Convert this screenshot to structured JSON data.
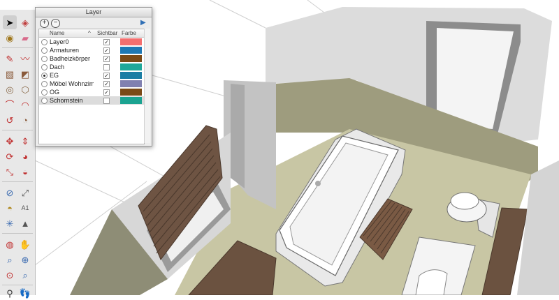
{
  "panel": {
    "title": "Layer",
    "add_icon": "+",
    "remove_icon": "−",
    "columns": {
      "name": "Name",
      "sort": "^",
      "visible": "Sichtbar",
      "color": "Farbe"
    }
  },
  "layers": [
    {
      "name": "Layer0",
      "active": false,
      "visible": true,
      "color": "#f46f6f"
    },
    {
      "name": "Armaturen",
      "active": false,
      "visible": true,
      "color": "#1e78b4"
    },
    {
      "name": "Badheizkörper",
      "active": false,
      "visible": true,
      "color": "#7a4a17"
    },
    {
      "name": "Dach",
      "active": false,
      "visible": false,
      "color": "#1fa89a"
    },
    {
      "name": "EG",
      "active": true,
      "visible": true,
      "color": "#1b7ea4"
    },
    {
      "name": "Möbel Wohnzimmer",
      "active": false,
      "visible": true,
      "color": "#8080b0"
    },
    {
      "name": "OG",
      "active": false,
      "visible": true,
      "color": "#7a4a17"
    },
    {
      "name": "Schornstein",
      "active": false,
      "visible": false,
      "color": "#1ba391"
    }
  ],
  "checkmark": "✓",
  "scene_colors": {
    "wall_light": "#d4d4d4",
    "wall_mid": "#bfbfbf",
    "floor": "#c9c7a6",
    "tile": "#9c9a7b",
    "wood": "#6b5240",
    "tub": "#ffffff"
  }
}
